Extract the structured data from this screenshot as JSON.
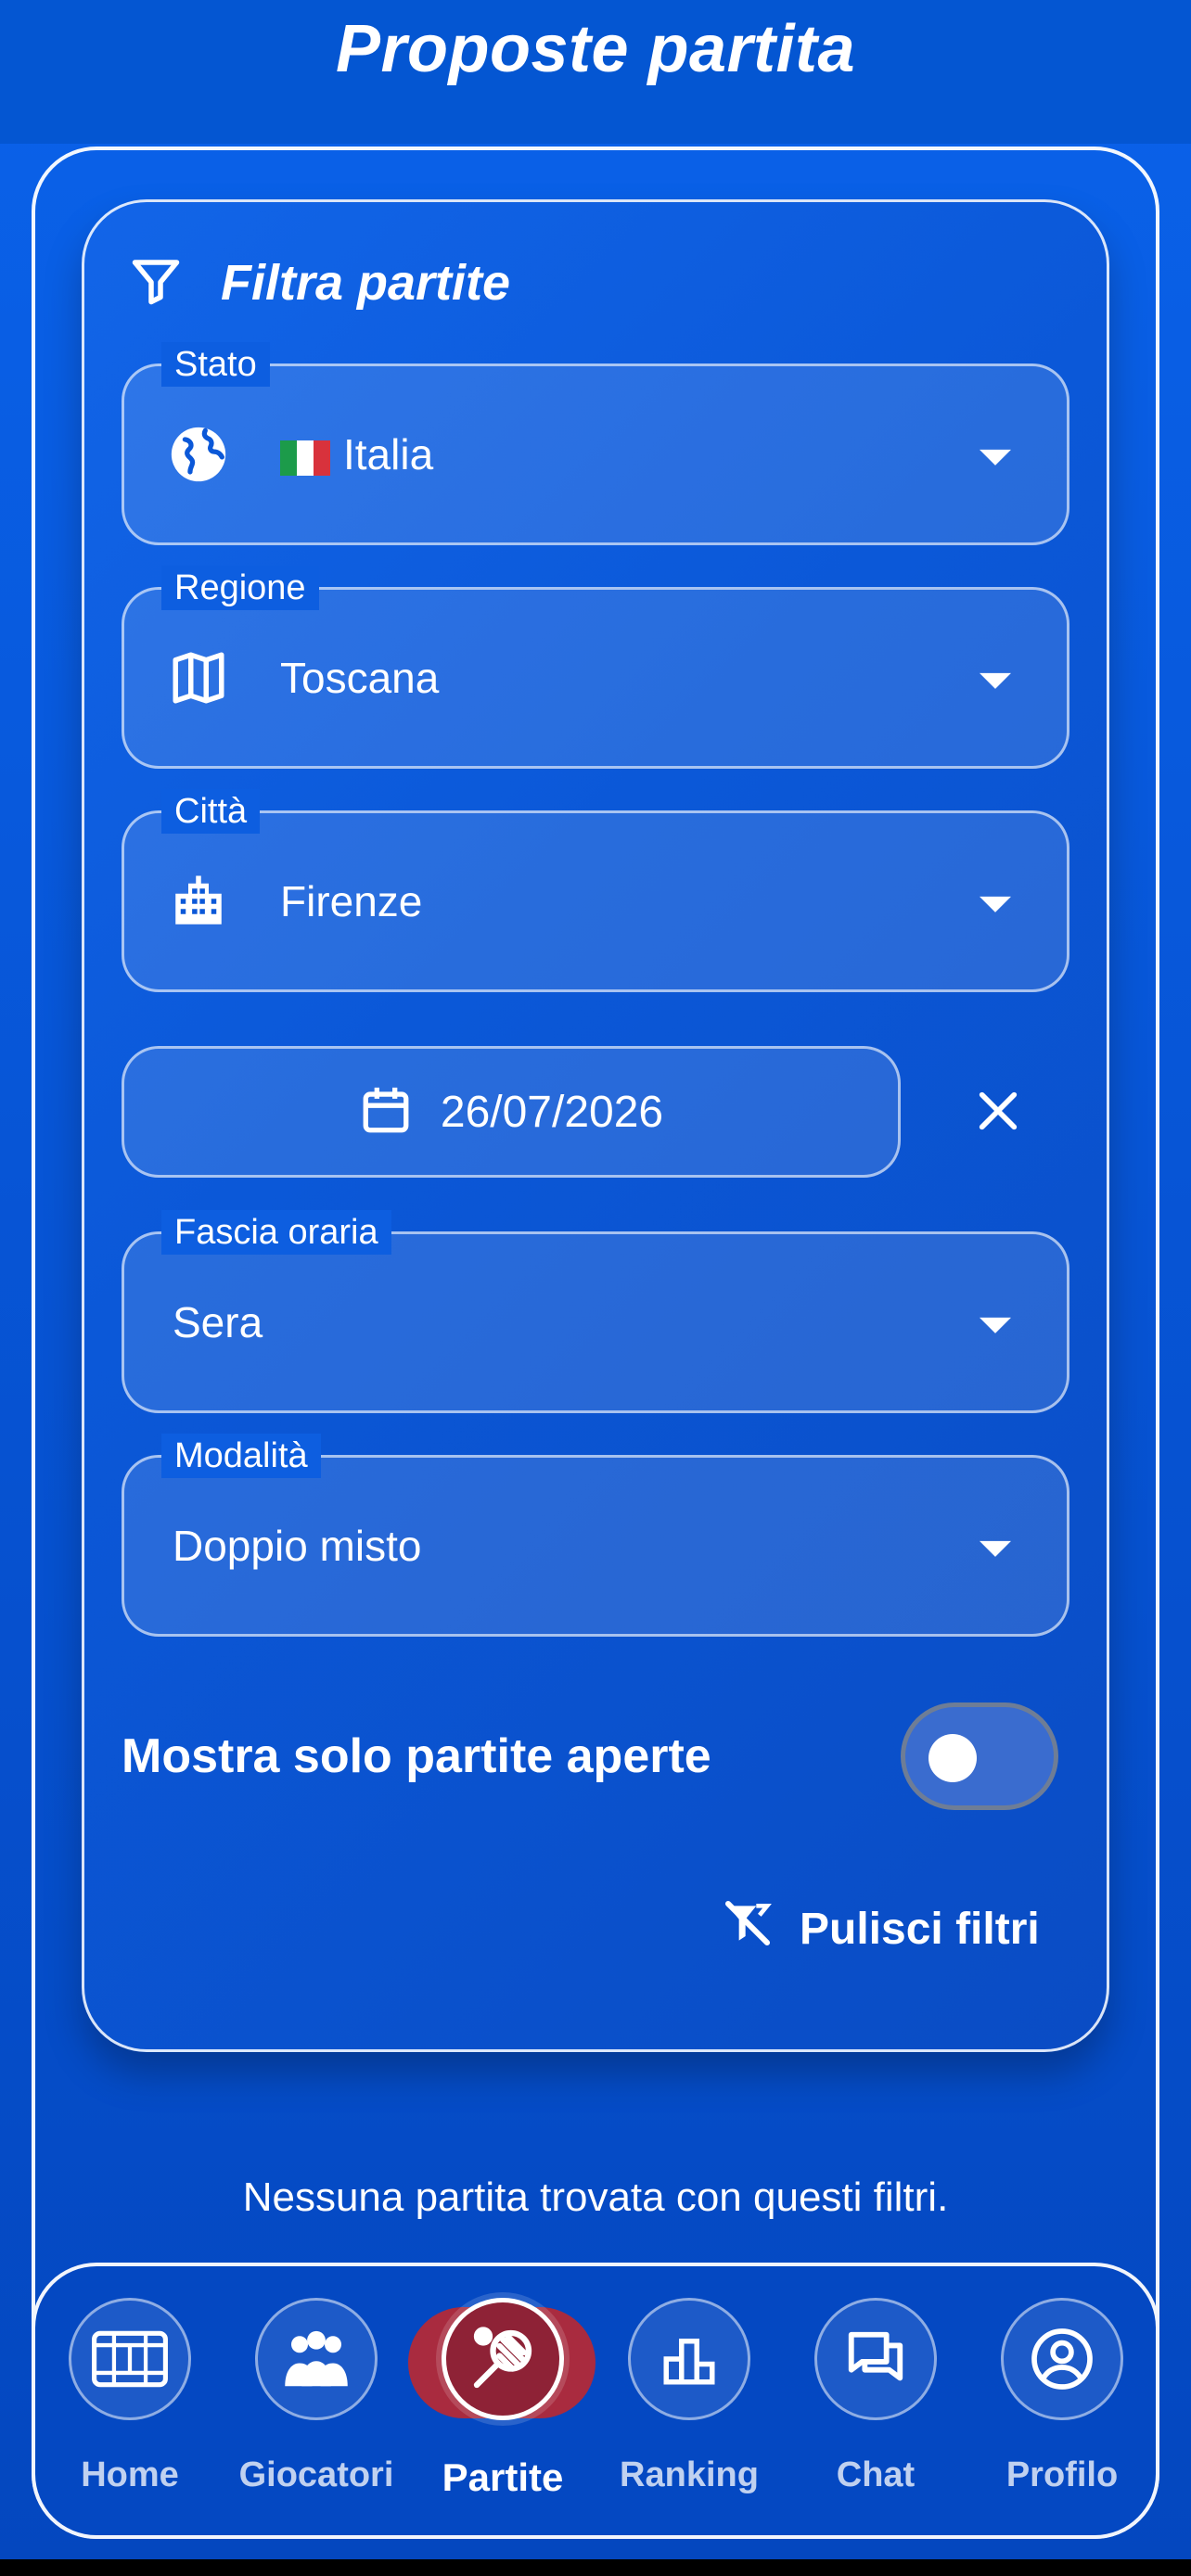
{
  "appbar": {
    "title": "Proposte partita"
  },
  "filters": {
    "title": "Filtra partite",
    "country": {
      "label": "Stato",
      "value": "Italia",
      "flag": "🇮🇹"
    },
    "region": {
      "label": "Regione",
      "value": "Toscana"
    },
    "city": {
      "label": "Città",
      "value": "Firenze"
    },
    "date": {
      "value": "26/07/2026"
    },
    "time_slot": {
      "label": "Fascia oraria",
      "value": "Sera"
    },
    "mode": {
      "label": "Modalità",
      "value": "Doppio misto"
    },
    "open_only": {
      "label": "Mostra solo partite aperte",
      "enabled": false
    },
    "clear_label": "Pulisci filtri"
  },
  "empty_message": "Nessuna partita trovata con questi filtri.",
  "nav": {
    "items": [
      {
        "label": "Home",
        "icon": "court-icon"
      },
      {
        "label": "Giocatori",
        "icon": "players-icon"
      },
      {
        "label": "Partite",
        "icon": "racket-icon",
        "active": true
      },
      {
        "label": "Ranking",
        "icon": "podium-icon"
      },
      {
        "label": "Chat",
        "icon": "chat-icon"
      },
      {
        "label": "Profilo",
        "icon": "profile-icon"
      }
    ]
  },
  "colors": {
    "background": "#0755d6",
    "appbar": "#0456d2",
    "active_nav": "#a92b3f"
  }
}
